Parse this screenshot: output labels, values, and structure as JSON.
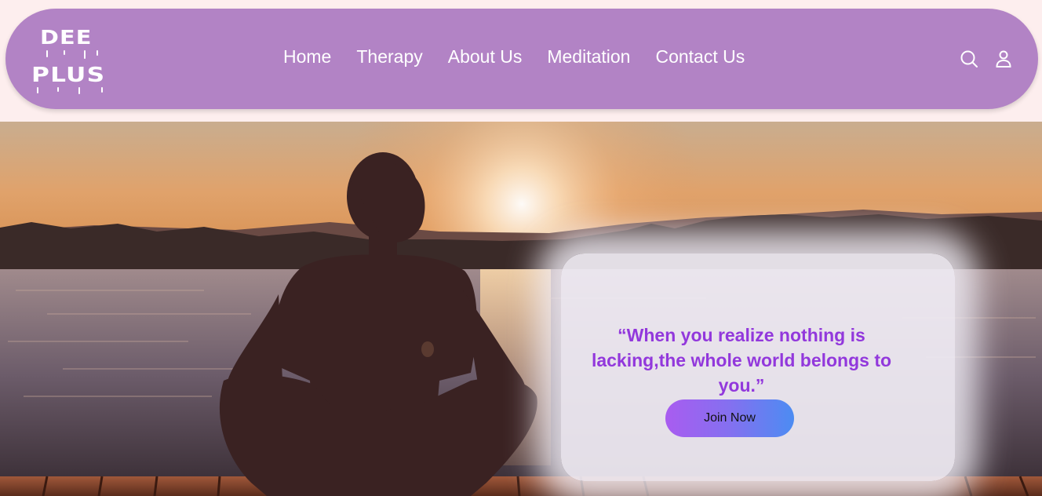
{
  "brand": {
    "logo_line1": "DEE",
    "logo_line2": "PLUS"
  },
  "nav": {
    "links": [
      "Home",
      "Therapy",
      "About Us",
      "Meditation",
      "Contact Us"
    ],
    "icons": [
      "search-icon",
      "user-icon"
    ]
  },
  "hero": {
    "quote": "“When you realize nothing is lacking,the whole world belongs to you.”",
    "button_label": "Join Now"
  },
  "colors": {
    "navbar_bg": "#b283c5",
    "page_bg": "#fdeeee",
    "quote_text": "#9238dc",
    "button_gradient_start": "#a95cf0",
    "button_gradient_end": "#4c8cf2"
  }
}
